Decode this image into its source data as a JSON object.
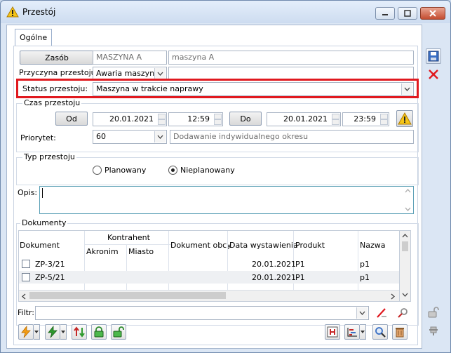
{
  "window": {
    "title": "Przestój",
    "icon": "warning-triangle-icon"
  },
  "tabs": [
    {
      "label": "Ogólne"
    }
  ],
  "resource": {
    "button_label": "Zasób",
    "code": "MASZYNA A",
    "name": "maszyna A"
  },
  "reason": {
    "label": "Przyczyna przestoju:",
    "value": "Awaria maszyny",
    "extra": ""
  },
  "status": {
    "label": "Status przestoju:",
    "value": "Maszyna w trakcie naprawy"
  },
  "time": {
    "group_label": "Czas przestoju",
    "from_label": "Od",
    "from_date": "20.01.2021",
    "from_time": "12:59",
    "to_label": "Do",
    "to_date": "20.01.2021",
    "to_time": "23:59"
  },
  "priority": {
    "label": "Priorytet:",
    "value": "60",
    "description": "Dodawanie indywidualnego okresu"
  },
  "type": {
    "group_label": "Typ przestoju",
    "options": [
      {
        "label": "Planowany",
        "selected": false
      },
      {
        "label": "Nieplanowany",
        "selected": true
      }
    ]
  },
  "description": {
    "label": "Opis:",
    "value": ""
  },
  "documents": {
    "group_label": "Dokumenty",
    "headers": {
      "document": "Dokument",
      "contractor": "Kontrahent",
      "acronym": "Akronim",
      "city": "Miasto",
      "foreign_doc": "Dokument obcy",
      "issue_date": "Data wystawienia",
      "product": "Produkt",
      "name": "Nazwa"
    },
    "rows": [
      {
        "document": "ZP-3/21",
        "acronym": "",
        "city": "",
        "foreign_doc": "",
        "issue_date": "20.01.2021",
        "product": "P1",
        "name": "p1",
        "checked": false
      },
      {
        "document": "ZP-5/21",
        "acronym": "",
        "city": "",
        "foreign_doc": "",
        "issue_date": "20.01.2021",
        "product": "P1",
        "name": "p1",
        "checked": false
      }
    ]
  },
  "filter": {
    "label": "Filtr:",
    "value": ""
  },
  "colors": {
    "highlight": "#e0191f",
    "window_bg": "#dbe6f4",
    "accent_green": "#2e9a2e"
  }
}
